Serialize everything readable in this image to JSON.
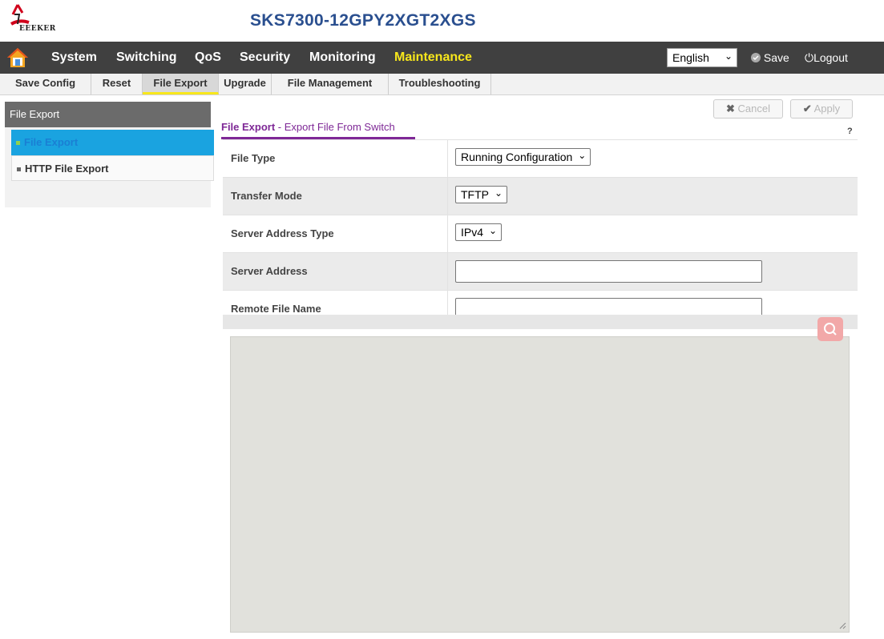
{
  "header": {
    "logo_text": "EEEKER",
    "device_name": "SKS7300-12GPY2XGT2XGS"
  },
  "colors": {
    "accent_yellow": "#f8e71c",
    "nav_bg": "#404040",
    "title_blue": "#2a4f8f",
    "page_title_purple": "#7e2896",
    "sidebar_active": "#1aa3e0"
  },
  "main_nav": {
    "home_icon": "home-icon",
    "items": [
      {
        "label": "System"
      },
      {
        "label": "Switching"
      },
      {
        "label": "QoS"
      },
      {
        "label": "Security"
      },
      {
        "label": "Monitoring"
      },
      {
        "label": "Maintenance",
        "active": true
      }
    ],
    "language": {
      "selected": "English"
    },
    "save_label": "Save",
    "logout_label": "Logout"
  },
  "sub_nav": {
    "items": [
      {
        "label": "Save Config"
      },
      {
        "label": "Reset"
      },
      {
        "label": "File Export",
        "active": true
      },
      {
        "label": "Upgrade"
      },
      {
        "label": "File Management"
      },
      {
        "label": "Troubleshooting"
      }
    ]
  },
  "sidebar": {
    "header": "File Export",
    "items": [
      {
        "label": "File Export",
        "active": true
      },
      {
        "label": "HTTP File Export"
      }
    ]
  },
  "actions": {
    "cancel_label": "Cancel",
    "apply_label": "Apply"
  },
  "page": {
    "title": "File Export",
    "subtitle": " - Export File From Switch",
    "help": "?"
  },
  "form": {
    "file_type": {
      "label": "File Type",
      "value": "Running Configuration"
    },
    "transfer_mode": {
      "label": "Transfer Mode",
      "value": "TFTP"
    },
    "server_address_type": {
      "label": "Server Address Type",
      "value": "IPv4"
    },
    "server_address": {
      "label": "Server Address",
      "value": ""
    },
    "remote_file_name": {
      "label": "Remote File Name",
      "value": ""
    }
  }
}
